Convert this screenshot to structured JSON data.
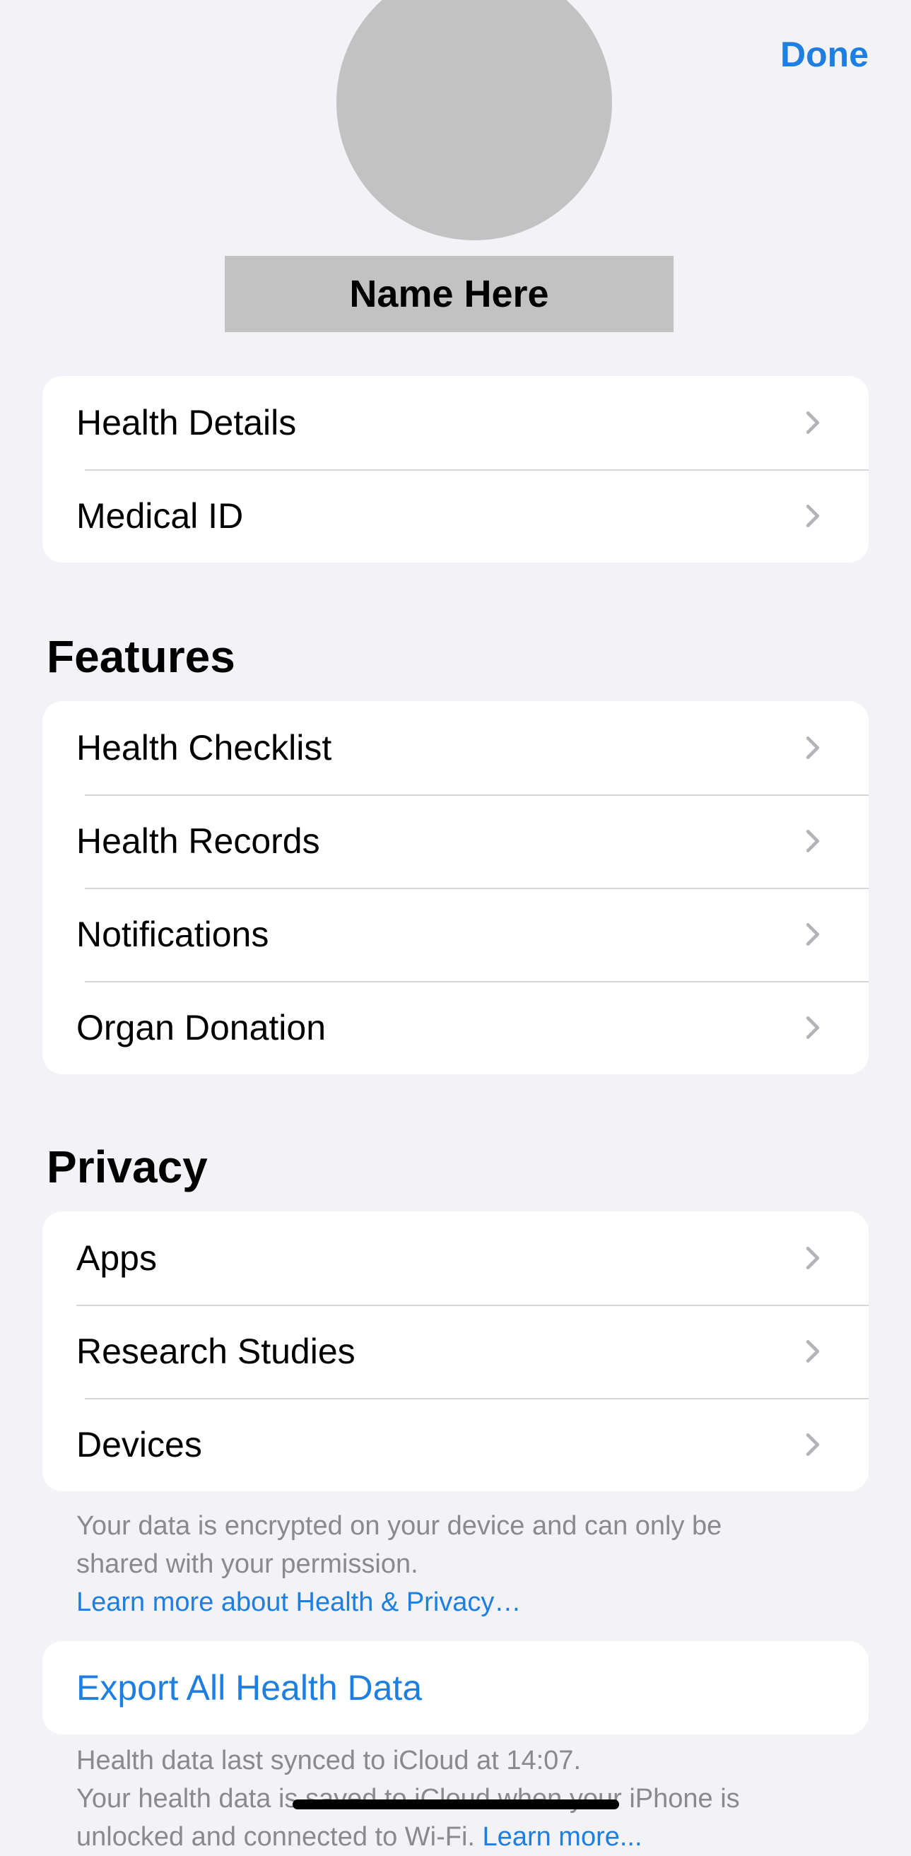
{
  "header": {
    "done_label": "Done",
    "profile_name": "Name Here"
  },
  "profile_group": {
    "items": [
      {
        "label": "Health Details"
      },
      {
        "label": "Medical ID"
      }
    ]
  },
  "features": {
    "heading": "Features",
    "items": [
      {
        "label": "Health Checklist"
      },
      {
        "label": "Health Records"
      },
      {
        "label": "Notifications"
      },
      {
        "label": "Organ Donation"
      }
    ]
  },
  "privacy": {
    "heading": "Privacy",
    "items": [
      {
        "label": "Apps"
      },
      {
        "label": "Research Studies"
      },
      {
        "label": "Devices"
      }
    ],
    "footnote_line1": "Your data is encrypted on your device and can only be",
    "footnote_line2": "shared with your permission.",
    "learn_more_link": "Learn more about Health & Privacy…"
  },
  "export": {
    "label": "Export All Health Data",
    "sync_note": "Health data last synced to iCloud at 14:07.",
    "icloud_line1": "Your health data is saved to iCloud when your iPhone is",
    "icloud_line2": "unlocked and connected to Wi-Fi.",
    "icloud_link": "Learn more..."
  },
  "colors": {
    "accent": "#1e7fe0",
    "background": "#f2f2f7",
    "card": "#ffffff",
    "secondary_text": "#8a8a8e",
    "placeholder_gray": "#c2c2c2"
  },
  "icons": {
    "row_chevron": "chevron-right-icon"
  }
}
